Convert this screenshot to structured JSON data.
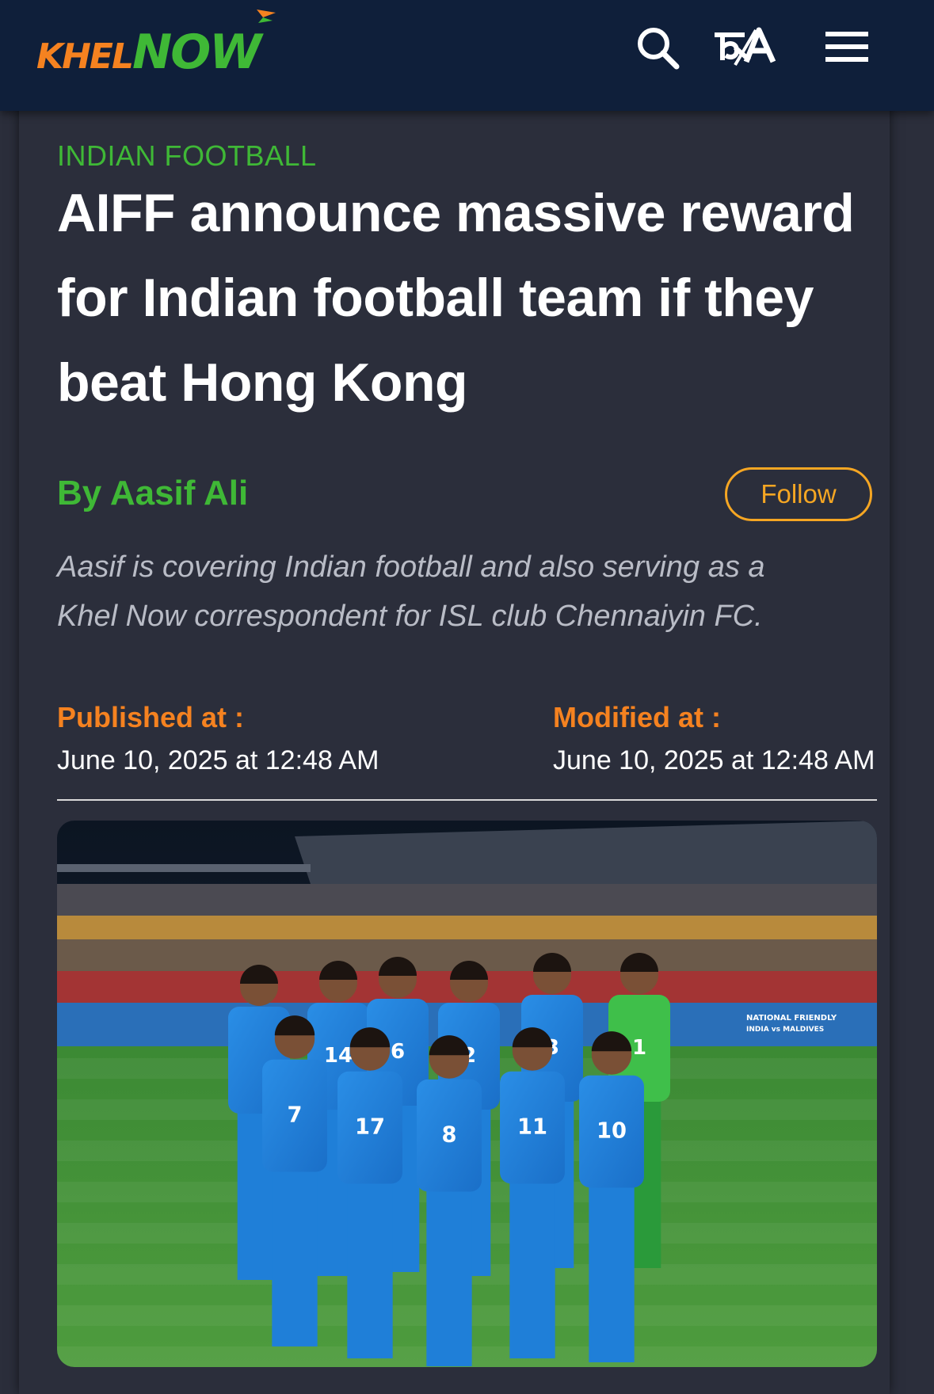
{
  "header": {
    "logo": {
      "khel": "KHEL",
      "now": "NOW"
    },
    "icons": [
      "search-icon",
      "language-toggle-icon",
      "hamburger-menu-icon"
    ],
    "language_toggle_glyph": "क/A"
  },
  "article": {
    "category": "INDIAN FOOTBALL",
    "headline_lines": [
      "AIFF announce massive reward",
      "for Indian football team if they",
      "beat Hong Kong"
    ],
    "byline": "By Aasif Ali",
    "follow_label": "Follow",
    "bio_lines": [
      "Aasif is covering Indian football and also serving as a",
      "Khel Now correspondent for ISL club Chennaiyin FC."
    ],
    "published_label": "Published at :",
    "published_value": "June 10, 2025 at 12:48 AM",
    "modified_label": "Modified at :",
    "modified_value": "June 10, 2025 at 12:48 AM",
    "hero_image": {
      "subject": "indian-football-team-photo",
      "jersey_numbers": [
        "14",
        "6",
        "2",
        "3",
        "1",
        "7",
        "17",
        "8",
        "11",
        "10"
      ],
      "board_text": [
        "NATIONAL FRIENDLY",
        "INDIA vs MALDIVES"
      ]
    }
  },
  "colors": {
    "topbar": "#0f1f3a",
    "background": "#2b2e3b",
    "green": "#3fb836",
    "orange": "#f58220",
    "follow": "#f5a623",
    "text": "#ffffff",
    "muted": "#b9bcc6"
  }
}
